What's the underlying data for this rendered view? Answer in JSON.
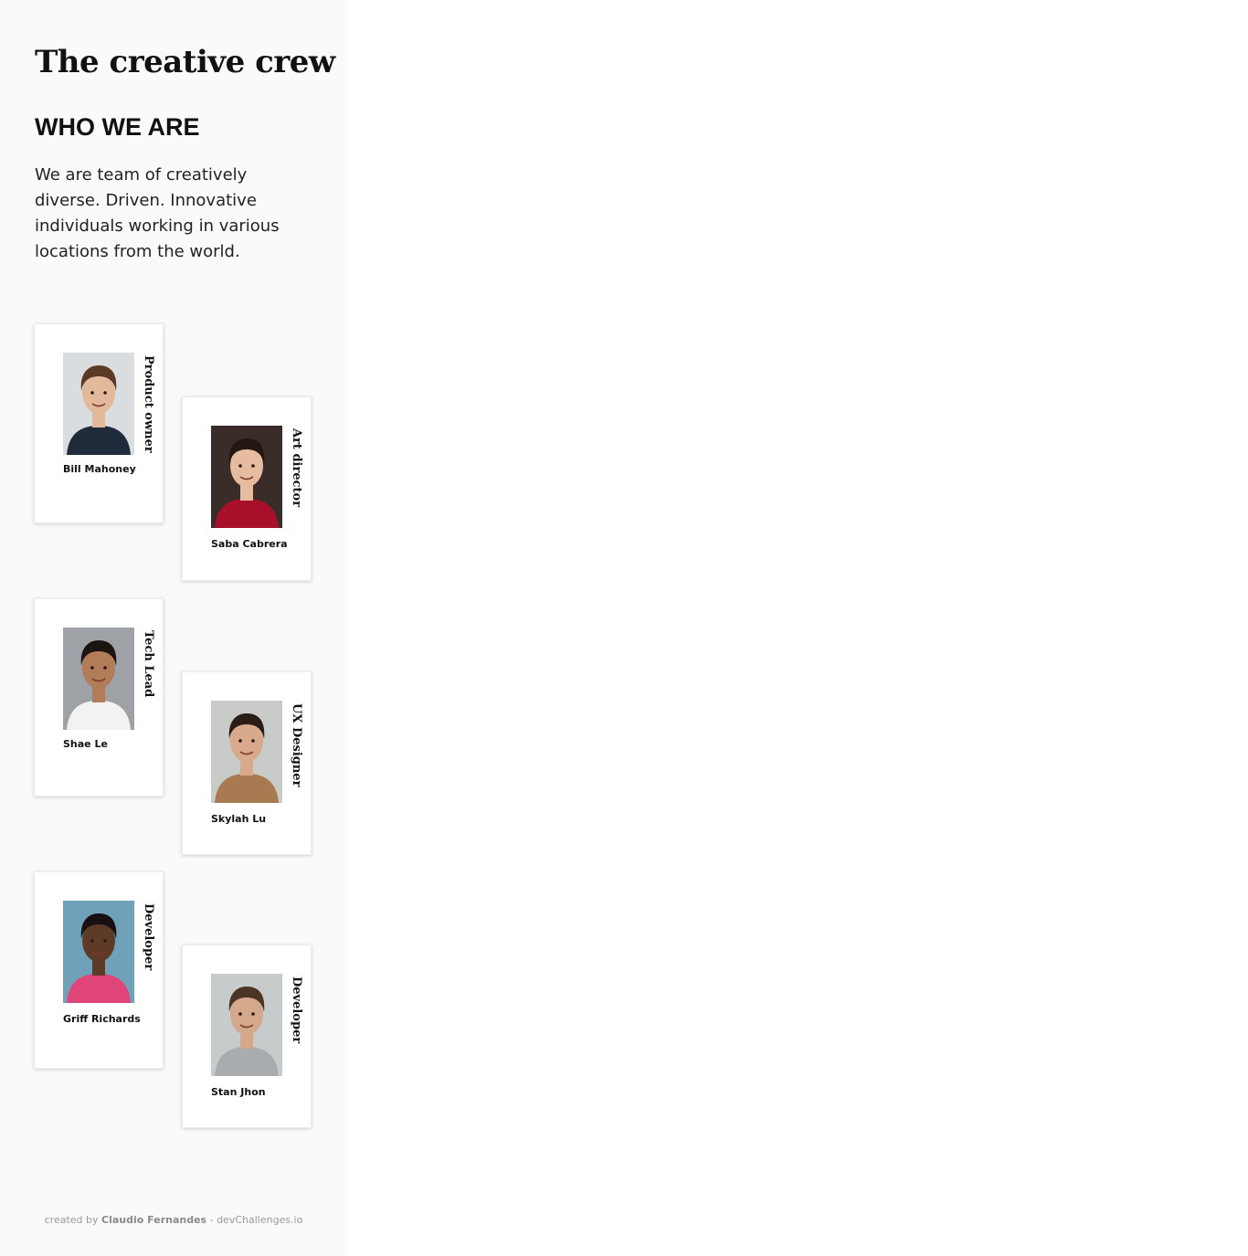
{
  "page": {
    "title": "The creative crew",
    "subtitle": "WHO WE ARE",
    "intro": "We are team of creatively diverse. Driven. Innovative individuals working in various locations from the world."
  },
  "members": [
    {
      "name": "Bill Mahoney",
      "role": "Product owner",
      "photo": "person-portrait",
      "colors": {
        "bg": "#d9dde0",
        "skin": "#e2b99a",
        "hair": "#5a3a26",
        "shirt": "#1f2b3a"
      }
    },
    {
      "name": "Saba Cabrera",
      "role": "Art director",
      "photo": "person-portrait",
      "colors": {
        "bg": "#3a2c28",
        "skin": "#e6bba0",
        "hair": "#241712",
        "shirt": "#a8102a"
      }
    },
    {
      "name": "Shae Le",
      "role": "Tech Lead",
      "photo": "person-portrait",
      "colors": {
        "bg": "#9ea2a6",
        "skin": "#b27c58",
        "hair": "#1c1410",
        "shirt": "#f2f2f2"
      }
    },
    {
      "name": "Skylah Lu",
      "role": "UX Designer",
      "photo": "person-portrait",
      "colors": {
        "bg": "#c9cbc8",
        "skin": "#d8a98a",
        "hair": "#2a1d16",
        "shirt": "#a77a52"
      }
    },
    {
      "name": "Griff Richards",
      "role": "Developer",
      "photo": "person-portrait",
      "colors": {
        "bg": "#6fa2b8",
        "skin": "#5e3b26",
        "hair": "#161010",
        "shirt": "#e0457a"
      }
    },
    {
      "name": "Stan Jhon",
      "role": "Developer",
      "photo": "person-portrait",
      "colors": {
        "bg": "#c8cbcc",
        "skin": "#d4a88a",
        "hair": "#4a3423",
        "shirt": "#a9acae"
      }
    }
  ],
  "footer": {
    "prefix": "created by",
    "author": "Claudio Fernandes",
    "separator": "-",
    "site": "devChallenges.io"
  }
}
